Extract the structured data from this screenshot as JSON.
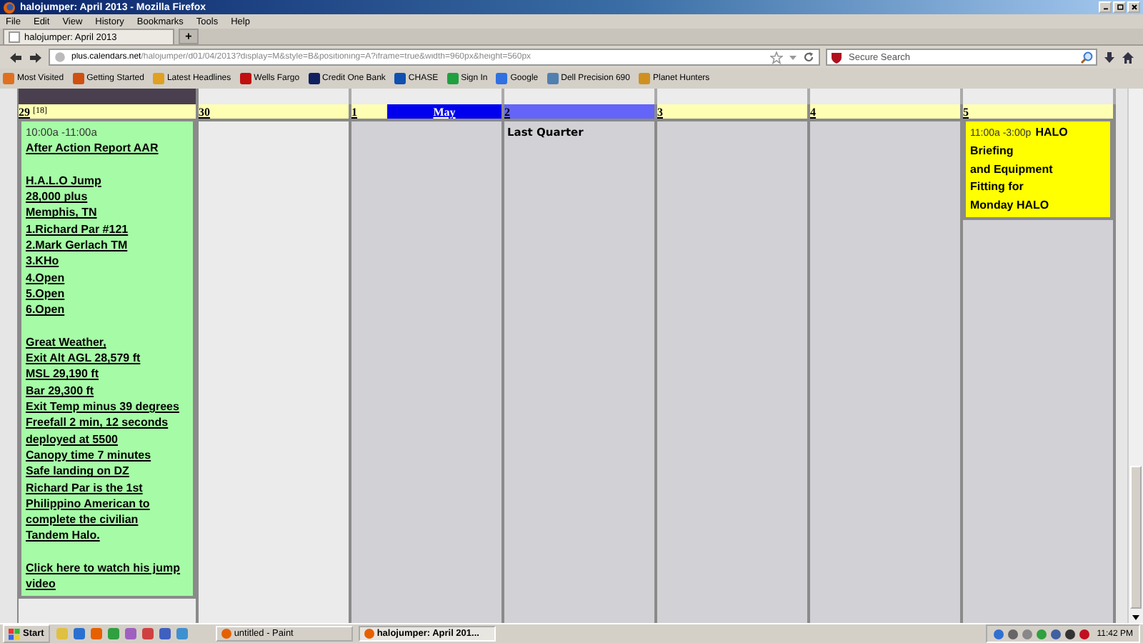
{
  "window": {
    "title": "halojumper: April 2013 - Mozilla Firefox"
  },
  "menu": [
    "File",
    "Edit",
    "View",
    "History",
    "Bookmarks",
    "Tools",
    "Help"
  ],
  "tabs": [
    {
      "label": "halojumper: April 2013",
      "selected": true
    }
  ],
  "new_tab": "+",
  "nav": {
    "url_host": "plus.calendars.net",
    "url_path": "/halojumper/d01/04/2013?display=M&style=B&positioning=A?iframe=true&width=960px&height=560px",
    "search_placeholder": "Secure Search"
  },
  "bookmarks": [
    {
      "label": "Most Visited",
      "color": "#e07020"
    },
    {
      "label": "Getting Started",
      "color": "#d05010"
    },
    {
      "label": "Latest Headlines",
      "color": "#e0a020"
    },
    {
      "label": "Wells Fargo",
      "color": "#c01010"
    },
    {
      "label": "Credit One Bank",
      "color": "#102060"
    },
    {
      "label": "CHASE",
      "color": "#1050b0"
    },
    {
      "label": "Sign In",
      "color": "#20a040"
    },
    {
      "label": "Google",
      "color": "#3070e0"
    },
    {
      "label": "Dell Precision 690",
      "color": "#5080b0"
    },
    {
      "label": "Planet Hunters",
      "color": "#d09020"
    }
  ],
  "calendar": {
    "days": [
      {
        "date": "29",
        "week": "[18]",
        "outside_month": false,
        "highlighted": false,
        "events": [
          {
            "kind": "note",
            "color": "#a6fba6",
            "time": "10:00a -11:00a",
            "paragraphs": [
              [
                "After Action Report AAR"
              ],
              [
                "H.A.L.O Jump",
                "28,000 plus",
                "Memphis, TN",
                "1.Richard Par #121",
                "2.Mark Gerlach TM",
                "3.KHo",
                "4.Open",
                "5.Open",
                "6.Open"
              ],
              [
                "Great Weather,",
                "Exit Alt AGL 28,579 ft",
                "MSL 29,190 ft",
                "Bar 29,300 ft",
                "Exit Temp minus 39 degrees",
                "Freefall 2 min, 12 seconds",
                "deployed at 5500",
                "Canopy time 7 minutes",
                "Safe landing on DZ",
                "Richard Par is the 1st",
                "Philippino American to",
                "complete the civilian",
                "Tandem Halo."
              ],
              [
                "Click here to watch his jump",
                "video"
              ]
            ]
          }
        ]
      },
      {
        "date": "30",
        "outside_month": false,
        "highlighted": false
      },
      {
        "date": "1",
        "month_label": "May",
        "outside_month": true,
        "highlighted": false
      },
      {
        "date": "2",
        "outside_month": true,
        "highlighted": true,
        "note": "Last Quarter"
      },
      {
        "date": "3",
        "outside_month": true,
        "highlighted": false
      },
      {
        "date": "4",
        "outside_month": true,
        "highlighted": false
      },
      {
        "date": "5",
        "outside_month": true,
        "highlighted": false,
        "events": [
          {
            "kind": "highlight",
            "color": "#ffff00",
            "time": "11:00a -3:00p",
            "paragraphs": [
              [
                "HALO",
                "Briefing",
                "and Equipment",
                "Fitting for",
                "Monday HALO"
              ]
            ]
          }
        ]
      }
    ]
  },
  "taskbar": {
    "start": "Start",
    "tasks": [
      {
        "label": "untitled - Paint",
        "selected": false
      },
      {
        "label": "halojumper: April 201...",
        "selected": true
      }
    ],
    "clock": "11:42 PM"
  }
}
